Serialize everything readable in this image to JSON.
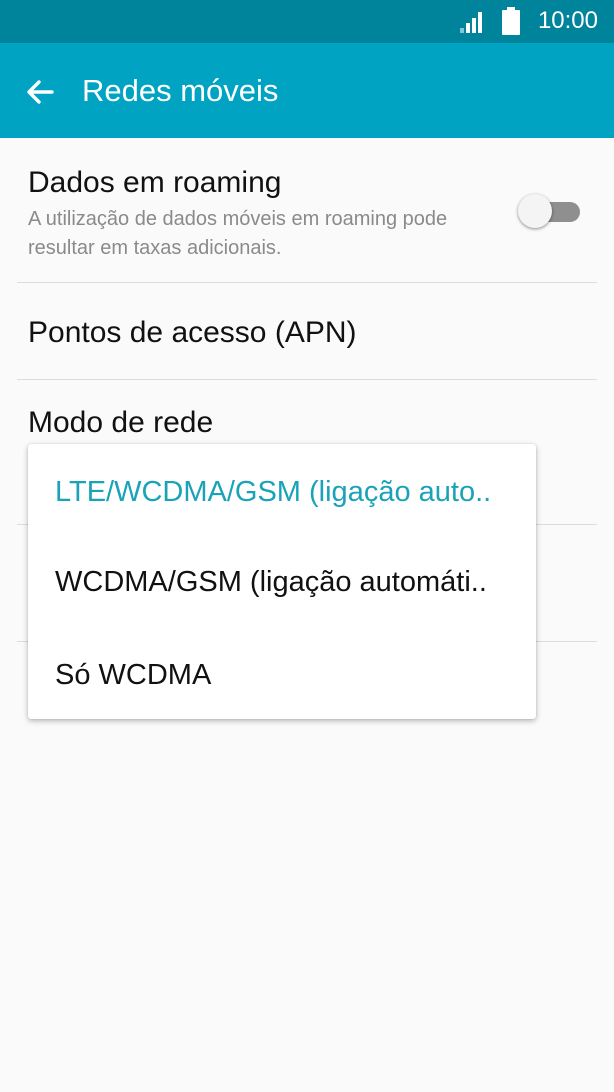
{
  "status_bar": {
    "time": "10:00",
    "signal_icon": "signal-icon",
    "battery_icon": "battery-icon"
  },
  "app_bar": {
    "title": "Redes móveis",
    "back_icon": "arrow-left-icon",
    "color": "#00a3c1",
    "status_color": "#00849b"
  },
  "settings": {
    "roaming": {
      "title": "Dados em roaming",
      "summary": "A utilização de dados móveis em roaming pode resultar em taxas adicionais.",
      "toggle_on": false
    },
    "apn": {
      "title": "Pontos de acesso (APN)"
    },
    "network_mode": {
      "title": "Modo de rede"
    }
  },
  "dropdown": {
    "accent_color": "#1aa3b8",
    "options": [
      {
        "label": "LTE/WCDMA/GSM (ligação auto..",
        "selected": true
      },
      {
        "label": "WCDMA/GSM (ligação automáti..",
        "selected": false
      },
      {
        "label": "Só WCDMA",
        "selected": false
      }
    ]
  }
}
